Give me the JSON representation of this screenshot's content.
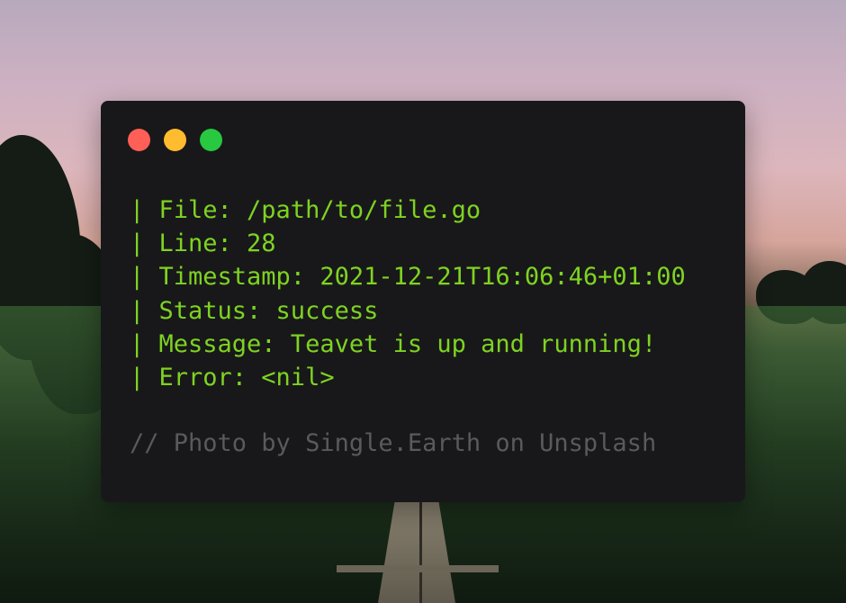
{
  "window": {
    "controls": [
      "close",
      "minimize",
      "zoom"
    ],
    "colors": {
      "close": "#ff5f57",
      "minimize": "#febc2e",
      "zoom": "#28c840",
      "text": "#7ed321",
      "comment": "#5a5a5c",
      "background": "#18181a"
    }
  },
  "log": {
    "lines": [
      "| File: /path/to/file.go",
      "| Line: 28",
      "| Timestamp: 2021-12-21T16:06:46+01:00",
      "| Status: success",
      "| Message: Teavet is up and running!",
      "| Error: <nil>"
    ]
  },
  "credit": "// Photo by Single.Earth on Unsplash"
}
